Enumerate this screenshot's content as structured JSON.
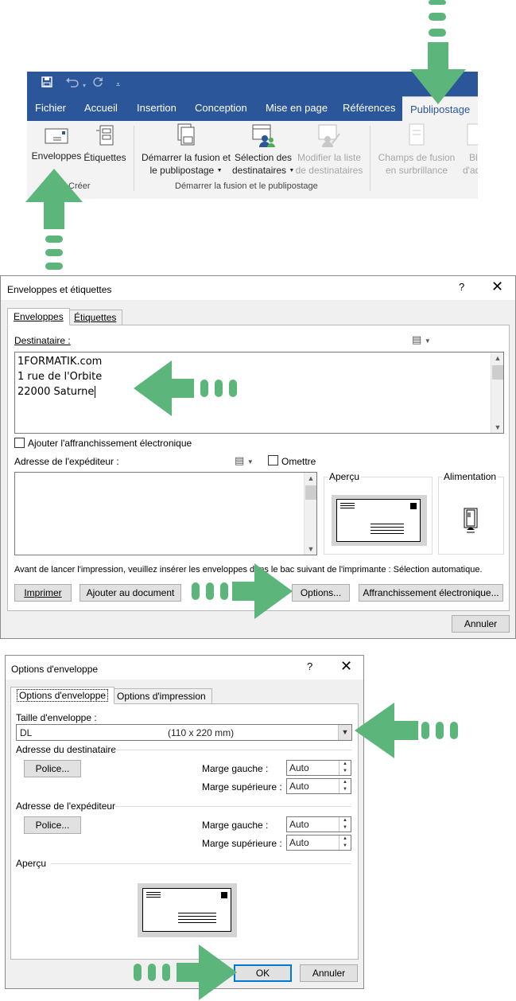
{
  "colors": {
    "word_blue": "#2b579a",
    "arrow_green": "#5cb57a",
    "default_button": "#0078d7"
  },
  "ribbon": {
    "qat_icons": [
      "save-icon",
      "undo-icon",
      "redo-icon",
      "customize-icon"
    ],
    "tabs": [
      "Fichier",
      "Accueil",
      "Insertion",
      "Conception",
      "Mise en page",
      "Références",
      "Publipostage"
    ],
    "active_tab": "Publipostage",
    "buttons": {
      "enveloppes": "Enveloppes",
      "etiquettes": "Étiquettes",
      "demarrer_l1": "Démarrer la fusion et",
      "demarrer_l2": "le publipostage",
      "selection_l1": "Sélection des",
      "selection_l2": "destinataires",
      "modifier_l1": "Modifier la liste",
      "modifier_l2": "de destinataires",
      "champs_l1": "Champs de fusion",
      "champs_l2": "en surbrillance",
      "bloc_l1": "Blo",
      "bloc_l2": "d'adr"
    },
    "group_creer": "Créer",
    "group_demarrer": "Démarrer la fusion et le publipostage"
  },
  "dialog1": {
    "title": "Enveloppes et étiquettes",
    "help": "?",
    "close": "✕",
    "tab_enveloppes": "Enveloppes",
    "tab_etiquettes": "Étiquettes",
    "destinataire_label": "Destinataire :",
    "address": [
      "1FORMATIK.com",
      "1 rue de l'Orbite",
      "22000 Saturne"
    ],
    "affranchissement_check": "Ajouter l'affranchissement électronique",
    "expediteur_label": "Adresse de l'expéditeur :",
    "omettre": "Omettre",
    "apercu": "Aperçu",
    "alimentation": "Alimentation",
    "notice": "Avant de lancer l'impression, veuillez insérer les enveloppes dans le bac suivant de l'imprimante : Sélection automatique.",
    "btn_imprimer": "Imprimer",
    "btn_ajouter": "Ajouter au document",
    "btn_options": "Options...",
    "btn_affranchissement": "Affranchissement électronique...",
    "btn_annuler": "Annuler"
  },
  "dialog2": {
    "title": "Options d'enveloppe",
    "help": "?",
    "close": "✕",
    "tab_options_enveloppe": "Options d'enveloppe",
    "tab_options_impression": "Options d'impression",
    "taille_label": "Taille d'enveloppe :",
    "taille_value": "DL",
    "taille_dims": "(110 x 220 mm)",
    "adr_dest_label": "Adresse du destinataire",
    "adr_exp_label": "Adresse de l'expéditeur",
    "police_btn": "Police...",
    "marge_gauche": "Marge gauche :",
    "marge_superieure": "Marge supérieure :",
    "dest_marge_gauche": "Auto",
    "dest_marge_superieure": "Auto",
    "exp_marge_gauche": "Auto",
    "exp_marge_superieure": "Auto",
    "apercu_label": "Aperçu",
    "btn_ok": "OK",
    "btn_annuler": "Annuler"
  }
}
